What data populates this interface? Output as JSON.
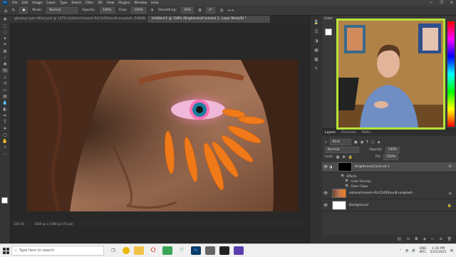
{
  "menu": {
    "items": [
      "File",
      "Edit",
      "Image",
      "Layer",
      "Type",
      "Select",
      "Filter",
      "3D",
      "View",
      "Plugins",
      "Window",
      "Help"
    ]
  },
  "options": {
    "mode_label": "Mode:",
    "mode_value": "Normal",
    "opacity_label": "Opacity:",
    "opacity_value": "100%",
    "flow_label": "Flow:",
    "flow_value": "100%",
    "smoothing_label": "Smoothing:",
    "smoothing_value": "10%",
    "angle_value": "0°"
  },
  "tabs": [
    {
      "label": "glowing eyes effect.psd @ 147% (sahand-hoseini-RnC2d5Xxuc8-unsplash, RGB/8) *"
    },
    {
      "label": "Untitled-1 @ 118% (Brightness/Contrast 1, Layer Mask/8) *"
    }
  ],
  "status": {
    "zoom": "118.1%",
    "doc": "1920 px x 1080 px (72 ppi)"
  },
  "color_panel": {
    "title": "Color"
  },
  "layers_panel": {
    "tabs": [
      "Layers",
      "Channels",
      "Paths"
    ],
    "kind": "Kind",
    "blend": "Normal",
    "opacity_label": "Opacity:",
    "opacity_value": "100%",
    "fill_label": "Fill:",
    "fill_value": "100%",
    "lock_label": "Lock:",
    "layers": [
      {
        "name": "Brightness/Contrast 1",
        "fx": "fx"
      },
      {
        "name": "sahand-hoseini-RnC2d5Xxuc8-unsplash"
      },
      {
        "name": "Background"
      }
    ],
    "effects_label": "Effects",
    "effects": [
      "Color Overlay",
      "Outer Glow"
    ]
  },
  "taskbar": {
    "search_placeholder": "Type here to search",
    "lang": "ENG",
    "region": "INTL",
    "time": "1:16 PM",
    "date": "5/21/2021"
  }
}
